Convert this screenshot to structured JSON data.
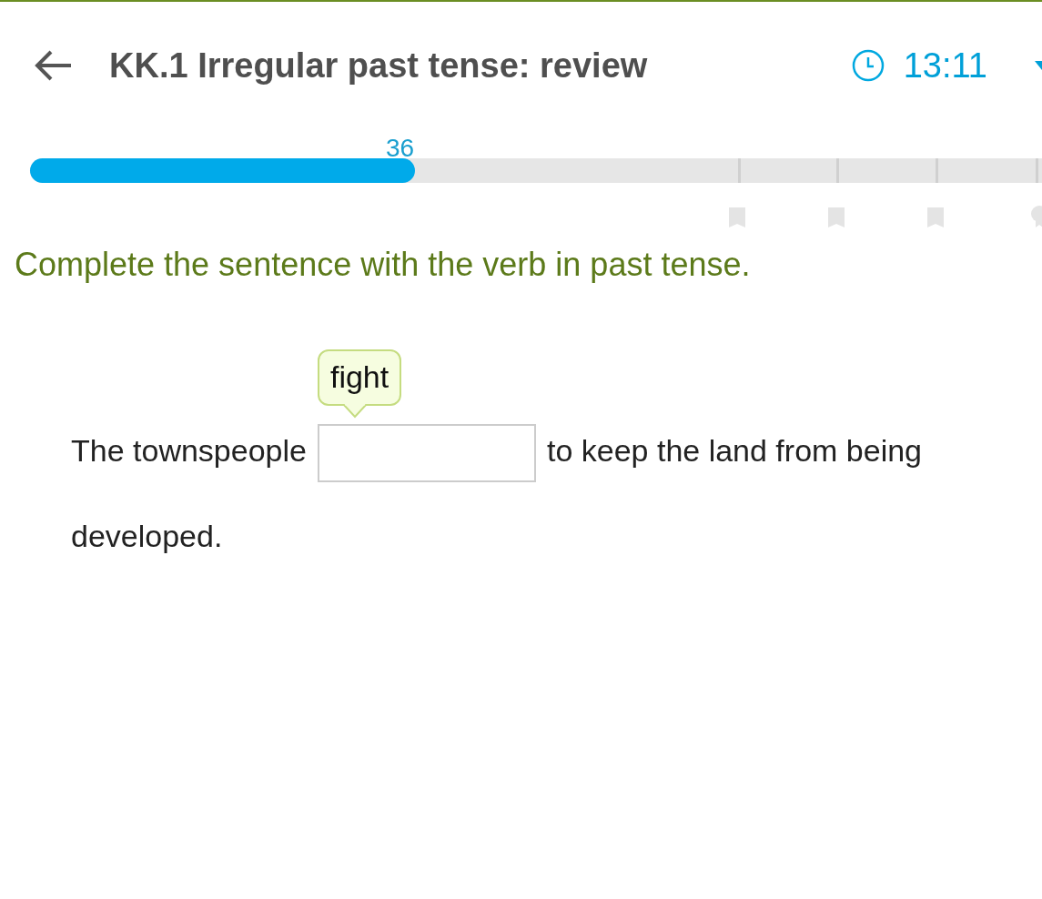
{
  "header": {
    "title": "KK.1 Irregular past tense: review",
    "timer": "13:11"
  },
  "progress": {
    "score": "36",
    "level": 0.38
  },
  "question": {
    "instruction": "Complete the sentence with the verb in past tense.",
    "hint": "fight",
    "before": "The townspeople",
    "after": "to keep the land from being",
    "end": "developed."
  }
}
